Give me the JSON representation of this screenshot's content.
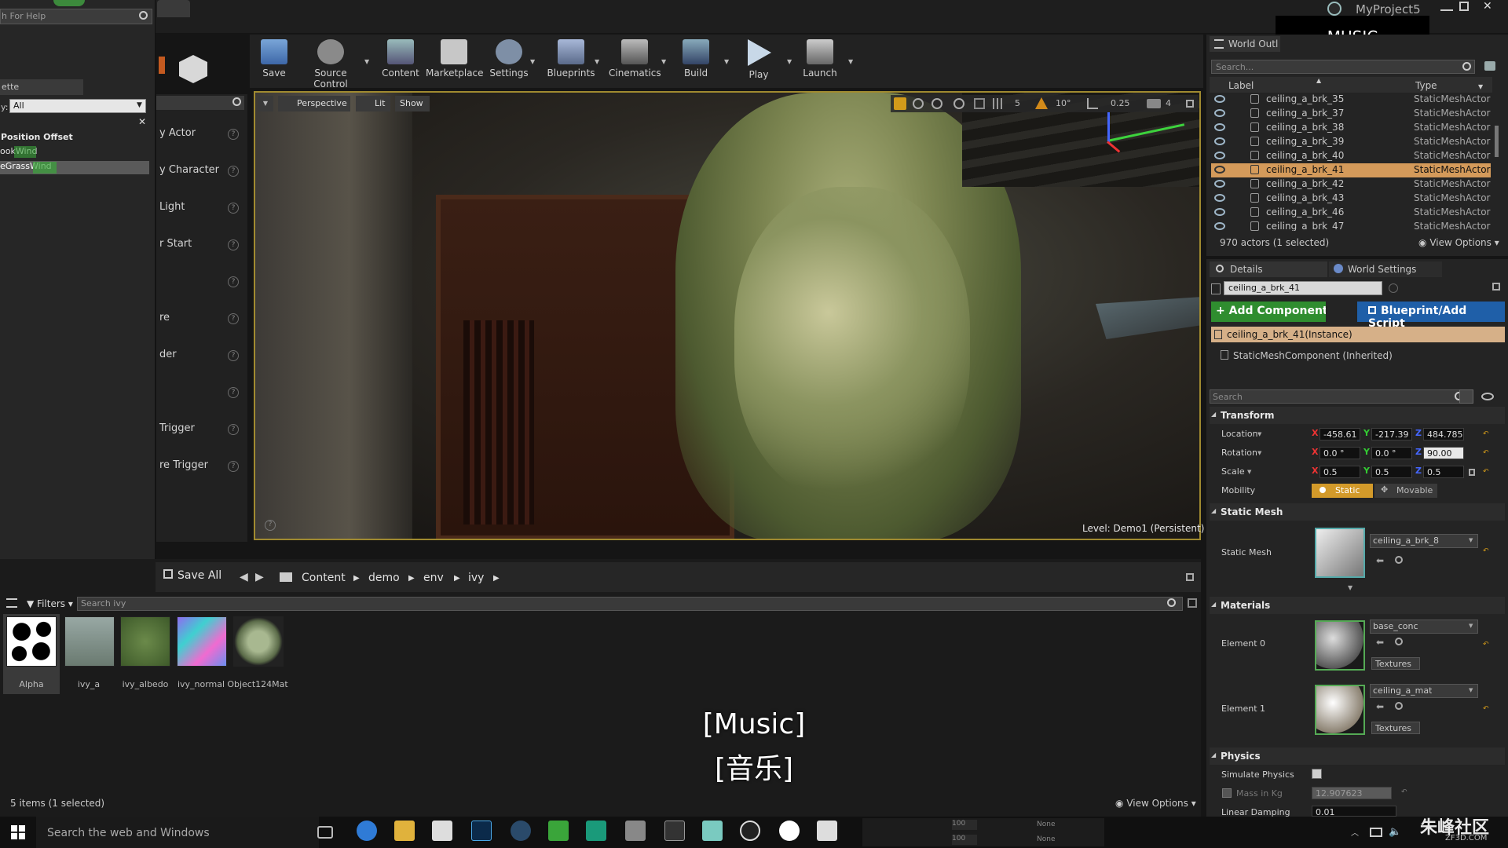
{
  "left_panel": {
    "search_placeholder": "h For Help",
    "tab_label": "ette",
    "filter_value": "All",
    "filter_prefix": "y:",
    "section_title": "Position Offset",
    "items": [
      "ookWind",
      "eGrassWind"
    ],
    "item_highlights": [
      "Wind",
      "Wind"
    ]
  },
  "place_items": [
    "y Actor",
    "y Character",
    "Light",
    "r Start",
    "",
    "re",
    "der",
    "",
    "Trigger",
    "re Trigger"
  ],
  "toolbar": {
    "save": "Save",
    "source_control": "Source Control",
    "content": "Content",
    "marketplace": "Marketplace",
    "settings": "Settings",
    "blueprints": "Blueprints",
    "cinematics": "Cinematics",
    "build": "Build",
    "play": "Play",
    "launch": "Launch"
  },
  "title_bar": {
    "project": "MyProject5"
  },
  "music_badge": "MUSIC",
  "viewport": {
    "perspective": "Perspective",
    "lit": "Lit",
    "show": "Show",
    "snap_angle": "10°",
    "snap_scale": "0.25",
    "camera_speed": "4",
    "grid_size": "5",
    "level_label": "Level:",
    "level_name": "Demo1 (Persistent)"
  },
  "subtitles": {
    "line1": "[Music]",
    "line2": "[音乐]"
  },
  "content_browser": {
    "save_all": "Save All",
    "breadcrumb": [
      "Content",
      "demo",
      "env",
      "ivy"
    ],
    "filters": "Filters",
    "search_placeholder": "Search ivy",
    "assets": [
      {
        "name": "Alpha",
        "selected": true
      },
      {
        "name": "ivy_a",
        "selected": false
      },
      {
        "name": "ivy_albedo",
        "selected": false
      },
      {
        "name": "ivy_normal",
        "selected": false
      },
      {
        "name": "Object124Mat",
        "selected": false
      }
    ],
    "status": "5 items (1 selected)",
    "view_options": "View Options"
  },
  "outliner": {
    "tab": "World Outl",
    "search_placeholder": "Search...",
    "col_label": "Label",
    "col_type": "Type",
    "rows": [
      {
        "label": "ceiling_a_brk_35",
        "type": "StaticMeshActor",
        "selected": false
      },
      {
        "label": "ceiling_a_brk_37",
        "type": "StaticMeshActor",
        "selected": false
      },
      {
        "label": "ceiling_a_brk_38",
        "type": "StaticMeshActor",
        "selected": false
      },
      {
        "label": "ceiling_a_brk_39",
        "type": "StaticMeshActor",
        "selected": false
      },
      {
        "label": "ceiling_a_brk_40",
        "type": "StaticMeshActor",
        "selected": false
      },
      {
        "label": "ceiling_a_brk_41",
        "type": "StaticMeshActor",
        "selected": true
      },
      {
        "label": "ceiling_a_brk_42",
        "type": "StaticMeshActor",
        "selected": false
      },
      {
        "label": "ceiling_a_brk_43",
        "type": "StaticMeshActor",
        "selected": false
      },
      {
        "label": "ceiling_a_brk_46",
        "type": "StaticMeshActor",
        "selected": false
      },
      {
        "label": "ceiling_a_brk_47",
        "type": "StaticMeshActor",
        "selected": false
      }
    ],
    "count": "970 actors (1 selected)",
    "view_options": "View Options"
  },
  "details": {
    "tab_details": "Details",
    "tab_world": "World Settings",
    "name": "ceiling_a_brk_41",
    "add_component": "+ Add Component",
    "blueprint_script": "Blueprint/Add Script",
    "instance": "ceiling_a_brk_41(Instance)",
    "component": "StaticMeshComponent (Inherited)",
    "search_placeholder": "Search",
    "transform": "Transform",
    "location_label": "Location",
    "rotation_label": "Rotation",
    "scale_label": "Scale",
    "mobility_label": "Mobility",
    "location": [
      "-458.61",
      "-217.39",
      "484.785"
    ],
    "rotation": [
      "0.0 °",
      "0.0 °",
      "90.00"
    ],
    "scale": [
      "0.5",
      "0.5",
      "0.5"
    ],
    "mobility_static": "Static",
    "mobility_movable": "Movable",
    "static_mesh_section": "Static Mesh",
    "static_mesh_label": "Static Mesh",
    "static_mesh_value": "ceiling_a_brk_8",
    "materials_section": "Materials",
    "element0": "Element 0",
    "element0_value": "base_conc",
    "element1": "Element 1",
    "element1_value": "ceiling_a_mat",
    "textures": "Textures",
    "physics_section": "Physics",
    "simulate_physics": "Simulate Physics",
    "mass": "Mass in Kg",
    "mass_value": "12.907623",
    "linear_damping": "Linear Damping",
    "linear_damping_value": "0.01"
  },
  "taskbar": {
    "search": "Search the web and Windows",
    "none1": "None",
    "none2": "None",
    "v1": "100",
    "v2": "100",
    "watermark": "朱峰社区",
    "watermark_sub": "ZF3D.COM"
  }
}
